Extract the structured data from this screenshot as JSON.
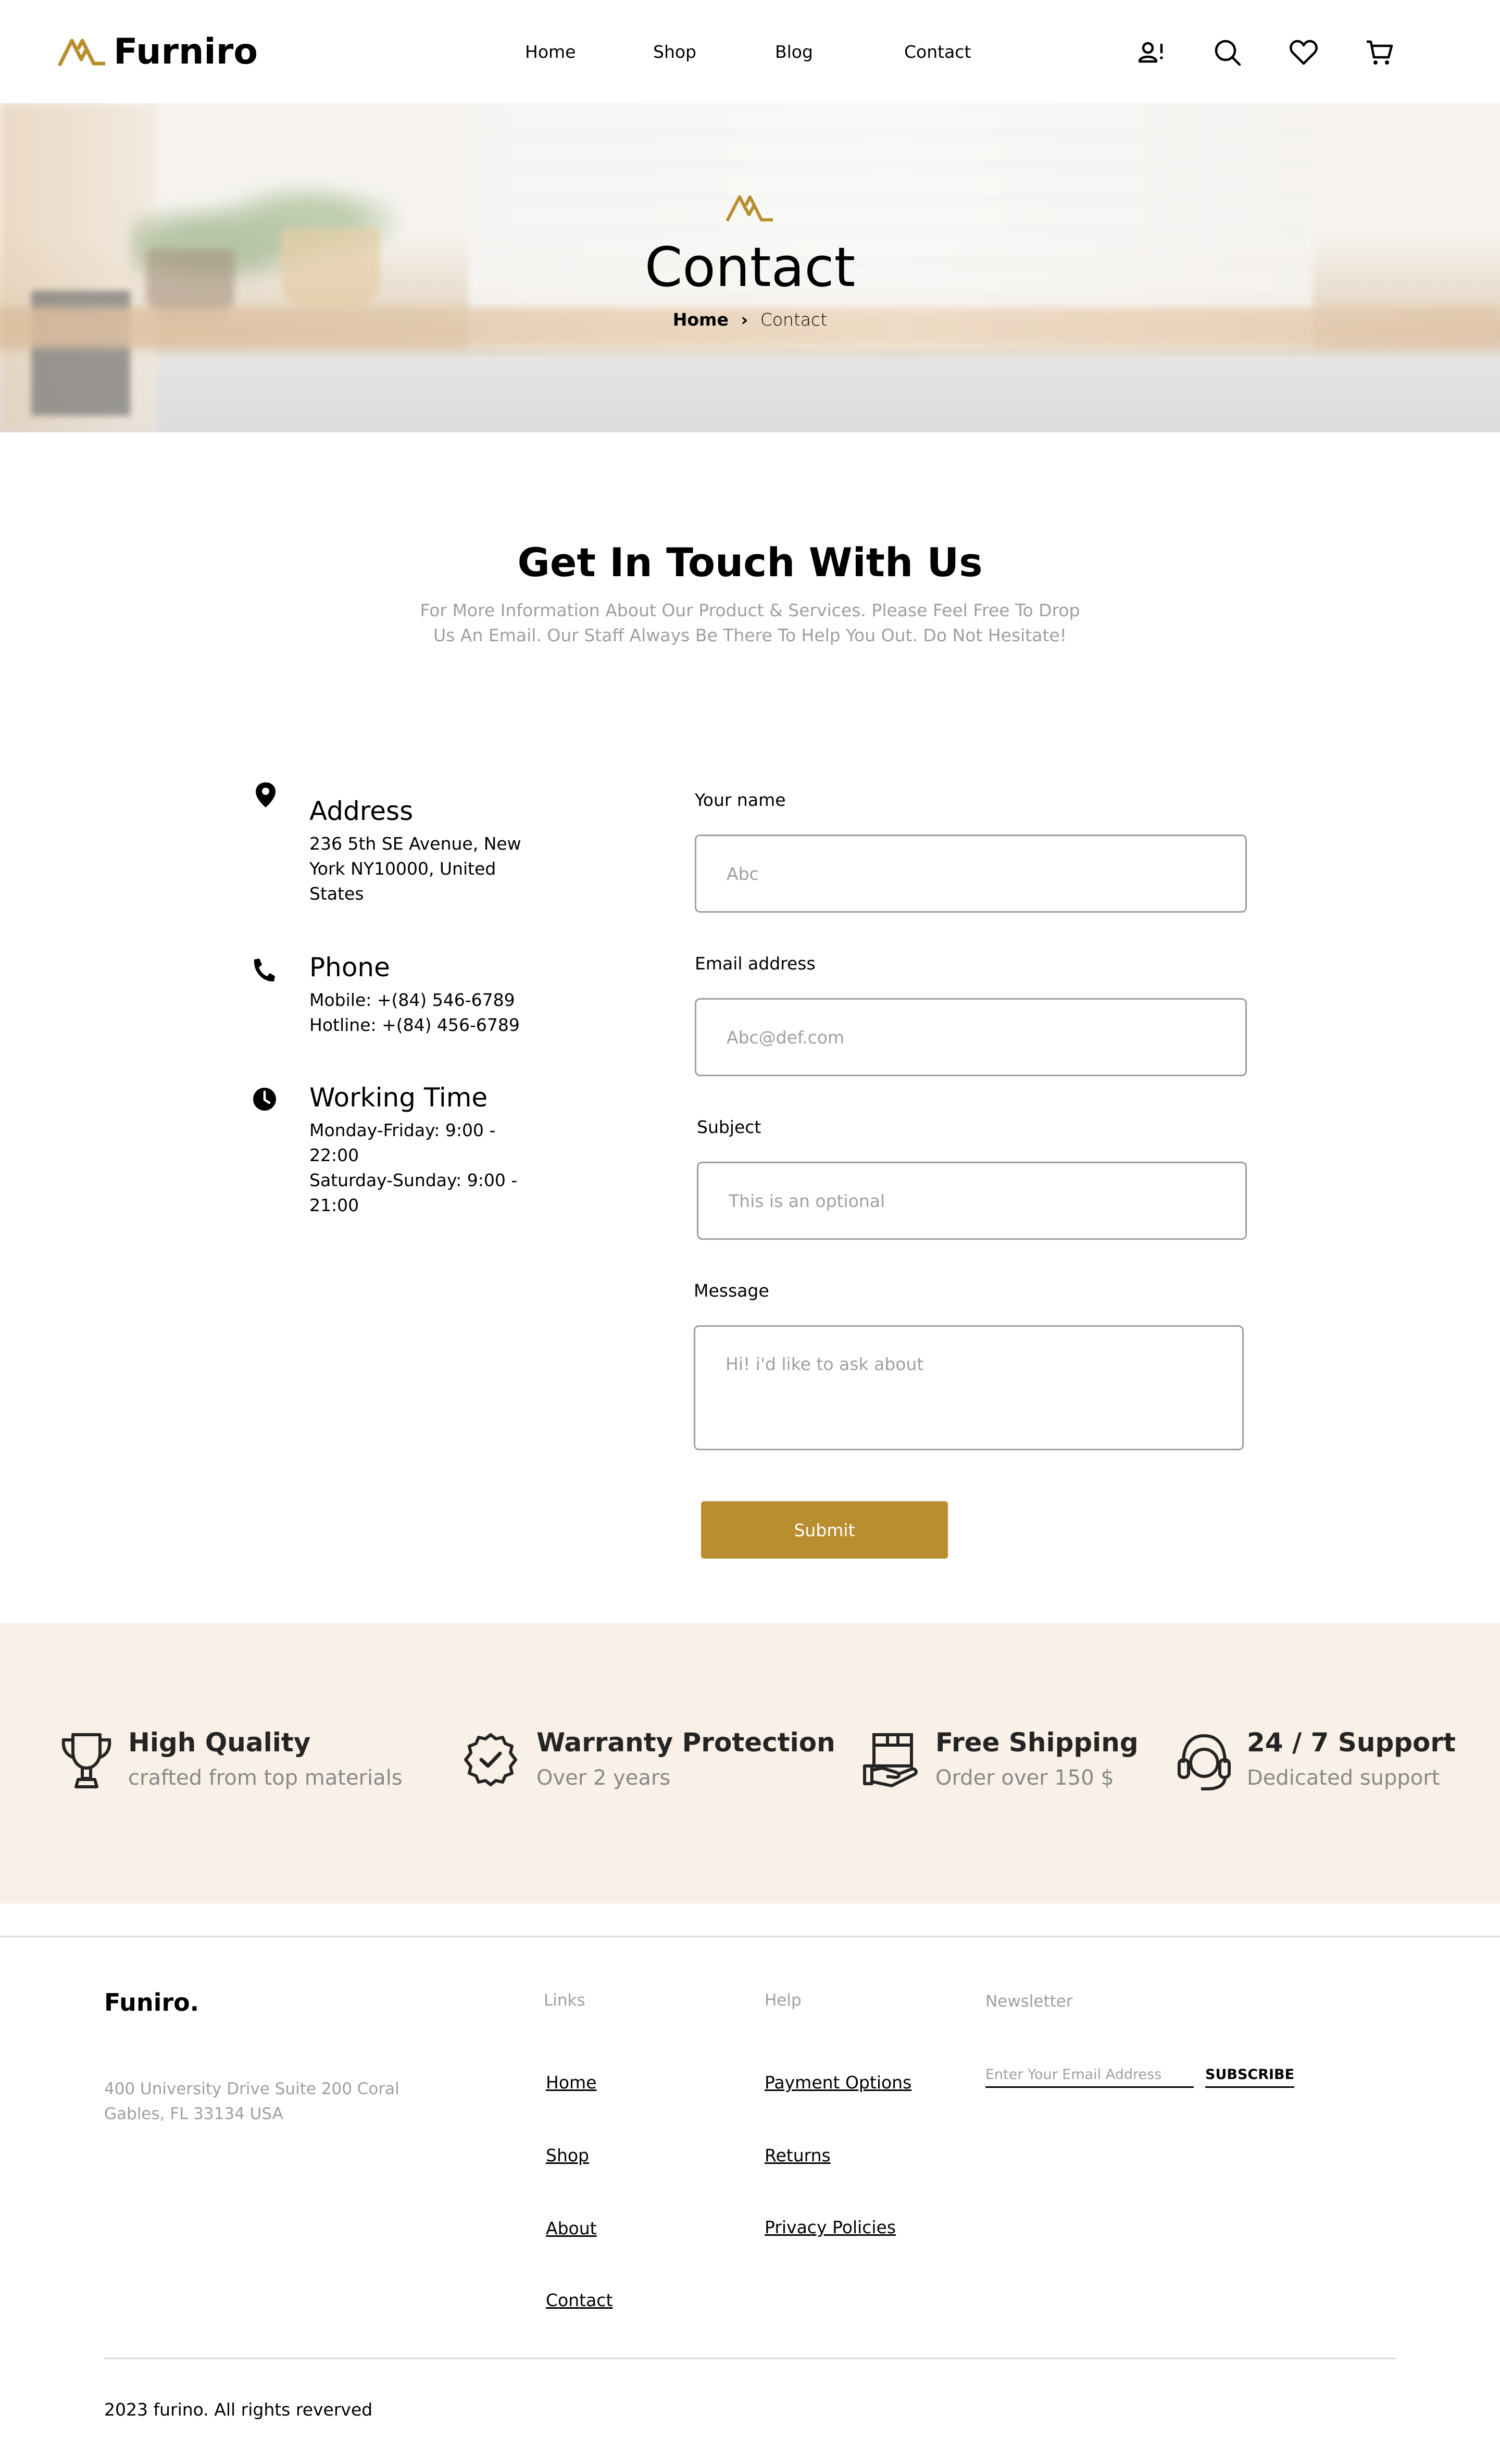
{
  "header": {
    "brand": "Furniro",
    "nav": [
      "Home",
      "Shop",
      "Blog",
      "Contact"
    ],
    "icons": [
      "user-alert-icon",
      "search-icon",
      "heart-icon",
      "cart-icon"
    ]
  },
  "hero": {
    "title": "Contact",
    "breadcrumb": {
      "home": "Home",
      "separator": "›",
      "current": "Contact"
    }
  },
  "intro": {
    "title": "Get In Touch With Us",
    "description": "For More Information About Our Product & Services. Please Feel Free To Drop Us An Email. Our Staff Always Be There To Help You Out. Do Not Hesitate!"
  },
  "info": [
    {
      "icon": "location-pin-icon",
      "heading": "Address",
      "lines": [
        "236 5th SE Avenue, New York NY10000, United States"
      ]
    },
    {
      "icon": "phone-icon",
      "heading": "Phone",
      "lines": [
        "Mobile: +(84) 546-6789",
        "Hotline: +(84) 456-6789"
      ]
    },
    {
      "icon": "clock-icon",
      "heading": "Working Time",
      "lines": [
        "Monday-Friday: 9:00 - 22:00",
        "Saturday-Sunday: 9:00 - 21:00"
      ]
    }
  ],
  "form": {
    "name": {
      "label": "Your name",
      "placeholder": "Abc",
      "value": ""
    },
    "email": {
      "label": "Email address",
      "placeholder": "Abc@def.com",
      "value": ""
    },
    "subject": {
      "label": "Subject",
      "placeholder": "This is an optional",
      "value": ""
    },
    "message": {
      "label": "Message",
      "placeholder": "Hi! i'd like to ask about",
      "value": ""
    },
    "submit": "Submit"
  },
  "features": [
    {
      "icon": "trophy-icon",
      "title": "High Quality",
      "subtitle": "crafted from top materials"
    },
    {
      "icon": "guarantee-check-icon",
      "title": "Warranty Protection",
      "subtitle": "Over 2 years"
    },
    {
      "icon": "shipping-box-icon",
      "title": "Free Shipping",
      "subtitle": "Order over 150 $"
    },
    {
      "icon": "headset-support-icon",
      "title": "24 / 7 Support",
      "subtitle": "Dedicated support"
    }
  ],
  "footer": {
    "brand": "Funiro.",
    "address": "400 University Drive Suite 200 Coral Gables, FL 33134 USA",
    "links_heading": "Links",
    "links": [
      "Home",
      "Shop",
      "About",
      "Contact"
    ],
    "help_heading": "Help",
    "help": [
      "Payment Options",
      "Returns",
      "Privacy Policies"
    ],
    "newsletter_heading": "Newsletter",
    "newsletter_placeholder": "Enter Your Email Address",
    "subscribe": "SUBSCRIBE",
    "copyright": "2023 furino. All rights reverved"
  },
  "colors": {
    "accent": "#B88E2F",
    "feature_bg": "#F9F1E7",
    "muted_text": "#9F9F9F",
    "divider": "#D9D9D9"
  }
}
